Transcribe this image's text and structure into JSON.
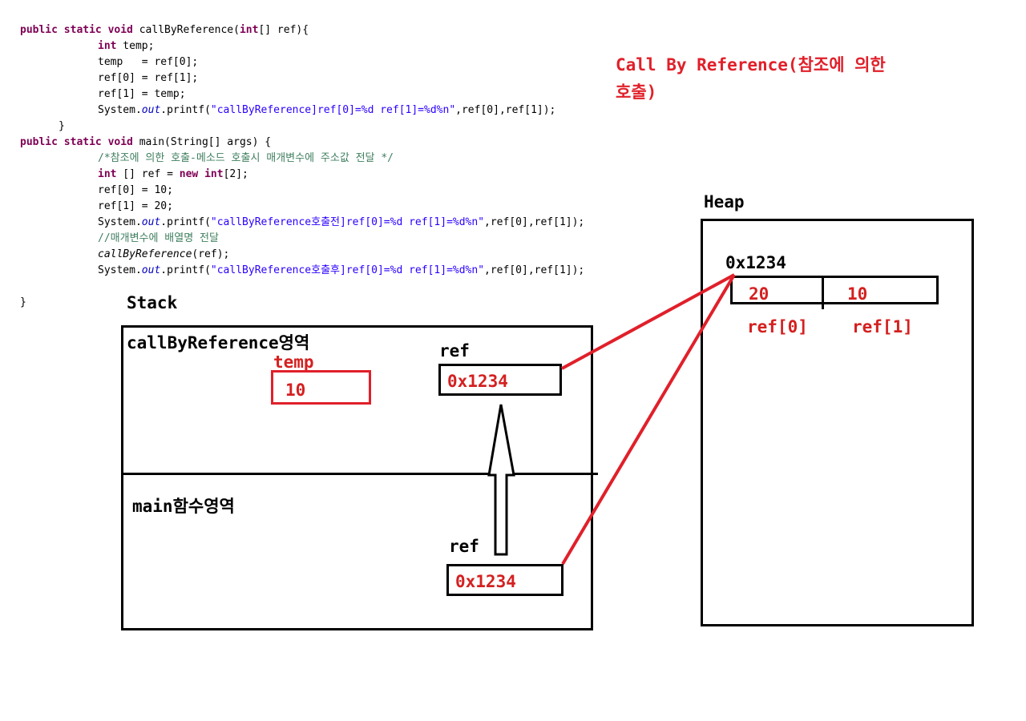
{
  "code": {
    "l1": {
      "kw": "public static void",
      "rest": " callByReference(",
      "kw2": "int",
      "rest2": "[] ref){"
    },
    "l2": {
      "kw": "int",
      "rest": " temp;"
    },
    "l3": "temp   = ref[0];",
    "l4": "ref[0] = ref[1];",
    "l5": "ref[1] = temp;",
    "l6": {
      "pre": "System.",
      "field": "out",
      "mid": ".printf(",
      "str": "\"callByReference]ref[0]=%d ref[1]=%d%n\"",
      "post": ",ref[0],ref[1]);"
    },
    "l7": "}",
    "l8": {
      "kw": "public static void",
      "rest": " main(String[] args) {"
    },
    "l9": "/*참조에 의한 호출-메소드 호출시 매개변수에 주소값 전달 */",
    "l10": {
      "kw": "int",
      "mid": " [] ref = ",
      "kw2": "new int",
      "rest": "[2];"
    },
    "l11": "ref[0] = 10;",
    "l12": "ref[1] = 20;",
    "l13": {
      "pre": "System.",
      "field": "out",
      "mid": ".printf(",
      "str": "\"callByReference호출전]ref[0]=%d ref[1]=%d%n\"",
      "post": ",ref[0],ref[1]);"
    },
    "l14": "//매개변수에 배열명 전달",
    "l15": {
      "call": "callByReference",
      "rest": "(ref);"
    },
    "l16": {
      "pre": "System.",
      "field": "out",
      "mid": ".printf(",
      "str": "\"callByReference호출후]ref[0]=%d ref[1]=%d%n\"",
      "post": ",ref[0],ref[1]);"
    },
    "l17": "}"
  },
  "title": {
    "line1": "Call By Reference(참조에 의한",
    "line2": "호출)"
  },
  "stack": {
    "label": "Stack",
    "callframe_label": "callByReference영역",
    "temp_label": "temp",
    "temp_value": "10",
    "callref_label": "ref",
    "callref_value": "0x1234",
    "main_label": "main함수영역",
    "mainref_label": "ref",
    "mainref_value": "0x1234"
  },
  "heap": {
    "label": "Heap",
    "address": "0x1234",
    "cell0_value": "20",
    "cell1_value": "10",
    "cell0_label": "ref[0]",
    "cell1_label": "ref[1]"
  },
  "colors": {
    "red": "#e0202a",
    "keyword": "#7f0055",
    "string": "#2a00ff",
    "comment": "#3f7f5f"
  }
}
